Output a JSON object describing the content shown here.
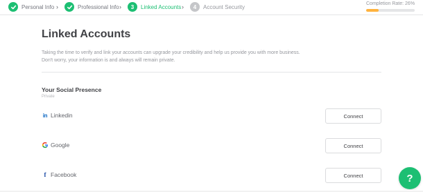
{
  "progress": {
    "steps": [
      {
        "number": "1",
        "label": "Personal Info",
        "state": "done"
      },
      {
        "number": "2",
        "label": "Professional Info",
        "state": "done"
      },
      {
        "number": "3",
        "label": "Linked Accounts",
        "state": "current"
      },
      {
        "number": "4",
        "label": "Account Security",
        "state": "todo"
      }
    ],
    "completion_label": "Completion Rate: 26%",
    "completion_fraction": 0.26
  },
  "page": {
    "title": "Linked Accounts",
    "intro_line1": "Taking the time to verify and link your accounts can upgrade your credibility and help us provide you with more business.",
    "intro_line2": "Don't worry, your information is and always will remain private."
  },
  "social": {
    "title": "Your Social Presence",
    "subtitle": "Private",
    "accounts": [
      {
        "name": "Linkedin",
        "icon": "linkedin-icon",
        "action": "Connect"
      },
      {
        "name": "Google",
        "icon": "google-icon",
        "action": "Connect"
      },
      {
        "name": "Facebook",
        "icon": "facebook-icon",
        "action": "Connect"
      }
    ]
  },
  "help": {
    "symbol": "?"
  },
  "colors": {
    "accent": "#1dbf73",
    "completion_fill": "#ffb33e",
    "linkedin": "#0a66c2",
    "facebook": "#1b4aa5"
  }
}
